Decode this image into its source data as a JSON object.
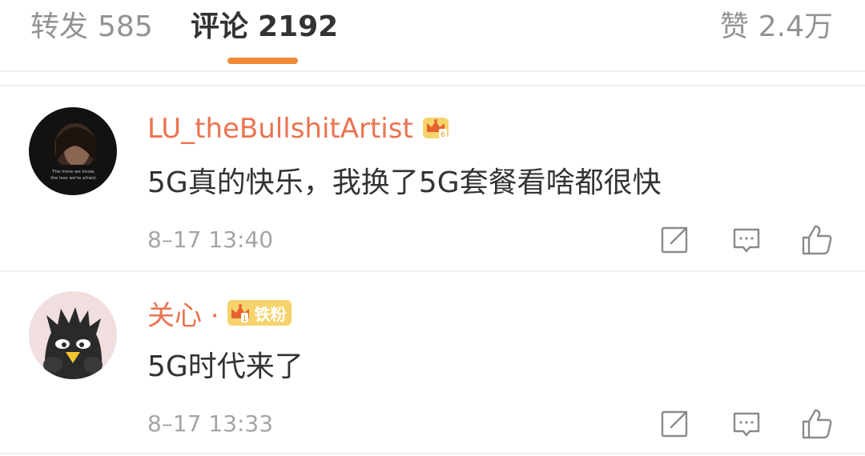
{
  "tabs": [
    {
      "label": "转发",
      "count": "585"
    },
    {
      "label": "评论",
      "count": "2192"
    },
    {
      "label": "赞",
      "count": "2.4万"
    }
  ],
  "comments": [
    {
      "username": "LU_theBullshitArtist",
      "text": "5G真的快乐，我换了5G套餐看啥都很快",
      "timestamp": "8–17 13:40",
      "avatar_caption": [
        "The more we know,",
        "the less we're afraid."
      ]
    },
    {
      "username": "关心 ·",
      "fan_badge": "铁粉",
      "text": "5G时代来了",
      "timestamp": "8–17 13:33"
    }
  ],
  "colors": {
    "accent": "#f08a36",
    "username": "#eb7350",
    "text": "#333333",
    "muted": "#a5a5a5",
    "badge": "#f6d36b"
  },
  "icons": {
    "action_share": "share-icon",
    "action_reply": "comment-icon",
    "action_like": "thumbs-up-icon",
    "member_badge": "crown-icon"
  }
}
